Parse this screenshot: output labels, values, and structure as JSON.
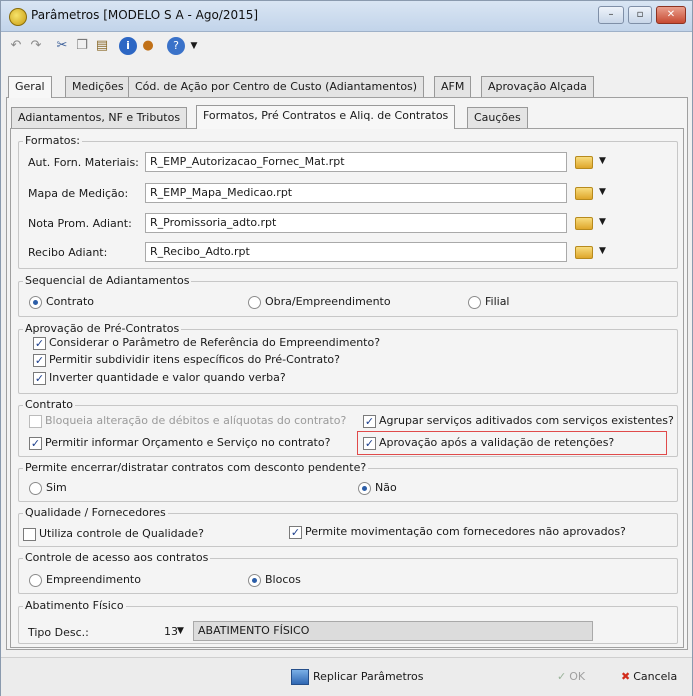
{
  "window": {
    "title": "Parâmetros [MODELO S A - Ago/2015]"
  },
  "toolbar": {
    "icons": [
      "undo-icon",
      "redo-icon",
      "cut-icon",
      "copy-icon",
      "paste-icon",
      "info-icon",
      "user-icon",
      "help-icon"
    ]
  },
  "tabs_top": [
    "Geral",
    "Medições",
    "Cód. de Ação por Centro de Custo (Adiantamentos)",
    "AFM",
    "Aprovação Alçada"
  ],
  "tabs_sub": [
    "Adiantamentos, NF e Tributos",
    "Formatos, Pré Contratos e Aliq. de Contratos",
    "Cauções"
  ],
  "formatos": {
    "title": "Formatos:",
    "rows": [
      {
        "label": "Aut. Forn. Materiais:",
        "value": "R_EMP_Autorizacao_Fornec_Mat.rpt"
      },
      {
        "label": "Mapa de Medição:",
        "value": "R_EMP_Mapa_Medicao.rpt"
      },
      {
        "label": "Nota Prom. Adiant:",
        "value": "R_Promissoria_adto.rpt"
      },
      {
        "label": "Recibo Adiant:",
        "value": "R_Recibo_Adto.rpt"
      }
    ]
  },
  "sequencial": {
    "title": "Sequencial de Adiantamentos",
    "options": [
      "Contrato",
      "Obra/Empreendimento",
      "Filial"
    ],
    "selected": "Contrato"
  },
  "aprovacao_pre": {
    "title": "Aprovação de Pré-Contratos",
    "items": [
      {
        "label": "Considerar o Parâmetro de Referência do Empreendimento?",
        "checked": true
      },
      {
        "label": "Permitir subdividir itens específicos do Pré-Contrato?",
        "checked": true
      },
      {
        "label": "Inverter quantidade e valor quando verba?",
        "checked": true
      }
    ]
  },
  "contrato": {
    "title": "Contrato",
    "items": [
      {
        "label": "Bloqueia alteração de débitos e alíquotas do contrato?",
        "checked": false,
        "disabled": true
      },
      {
        "label": "Agrupar serviços aditivados com serviços existentes?",
        "checked": true
      },
      {
        "label": "Permitir informar Orçamento e Serviço no contrato?",
        "checked": true
      },
      {
        "label": "Aprovação após a validação de retenções?",
        "checked": true
      }
    ]
  },
  "encerrar": {
    "title": "Permite encerrar/distratar contratos com desconto pendente?",
    "options": [
      "Sim",
      "Não"
    ],
    "selected": "Não"
  },
  "qualidade": {
    "title": "Qualidade / Fornecedores",
    "items": [
      {
        "label": "Utiliza controle de Qualidade?",
        "checked": false
      },
      {
        "label": "Permite movimentação com fornecedores não aprovados?",
        "checked": true
      }
    ]
  },
  "acesso": {
    "title": "Controle de acesso aos contratos",
    "options": [
      "Empreendimento",
      "Blocos"
    ],
    "selected": "Blocos"
  },
  "abatimento": {
    "title": "Abatimento Físico",
    "label": "Tipo Desc.:",
    "code": "13",
    "desc": "ABATIMENTO FÍSICO"
  },
  "footer": {
    "replicar": "Replicar Parâmetros",
    "ok": "OK",
    "cancelar": "Cancela"
  }
}
